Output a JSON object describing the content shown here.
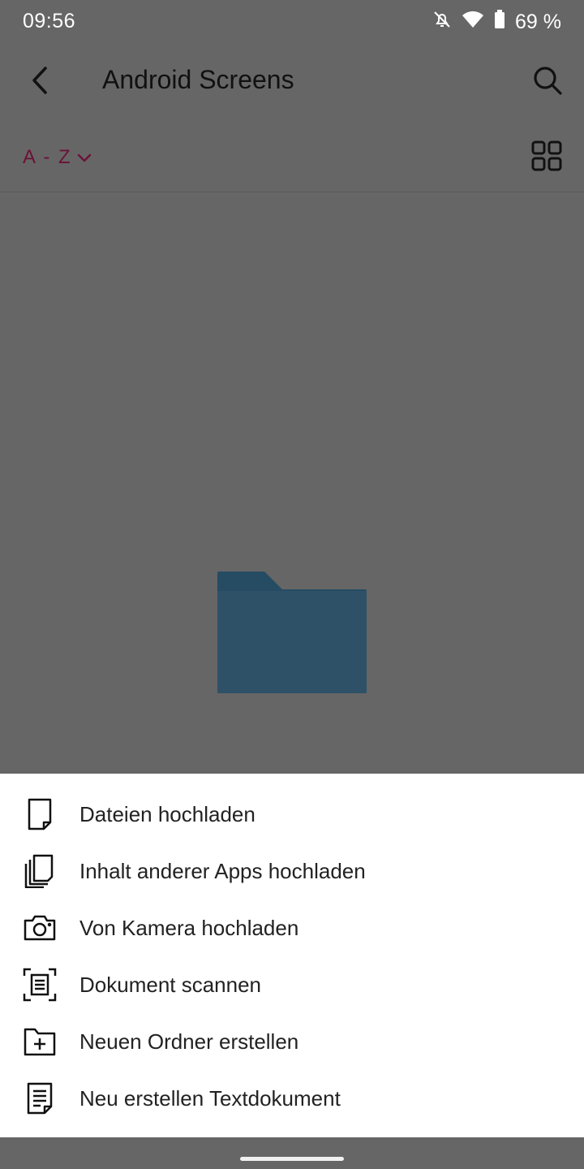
{
  "status": {
    "time": "09:56",
    "battery": "69 %"
  },
  "appbar": {
    "title": "Android Screens"
  },
  "sort": {
    "label": "A - Z"
  },
  "sheet": {
    "items": [
      {
        "label": "Dateien hochladen",
        "icon": "file-icon"
      },
      {
        "label": "Inhalt anderer Apps hochladen",
        "icon": "files-copy-icon"
      },
      {
        "label": "Von Kamera hochladen",
        "icon": "camera-icon"
      },
      {
        "label": "Dokument scannen",
        "icon": "scan-document-icon"
      },
      {
        "label": "Neuen Ordner erstellen",
        "icon": "new-folder-icon"
      },
      {
        "label": "Neu erstellen Textdokument",
        "icon": "text-document-icon"
      }
    ]
  },
  "colors": {
    "scrim": "#666666",
    "sort_accent": "#6b1238",
    "folder": "#2c5069",
    "sheet_bg": "#ffffff"
  }
}
